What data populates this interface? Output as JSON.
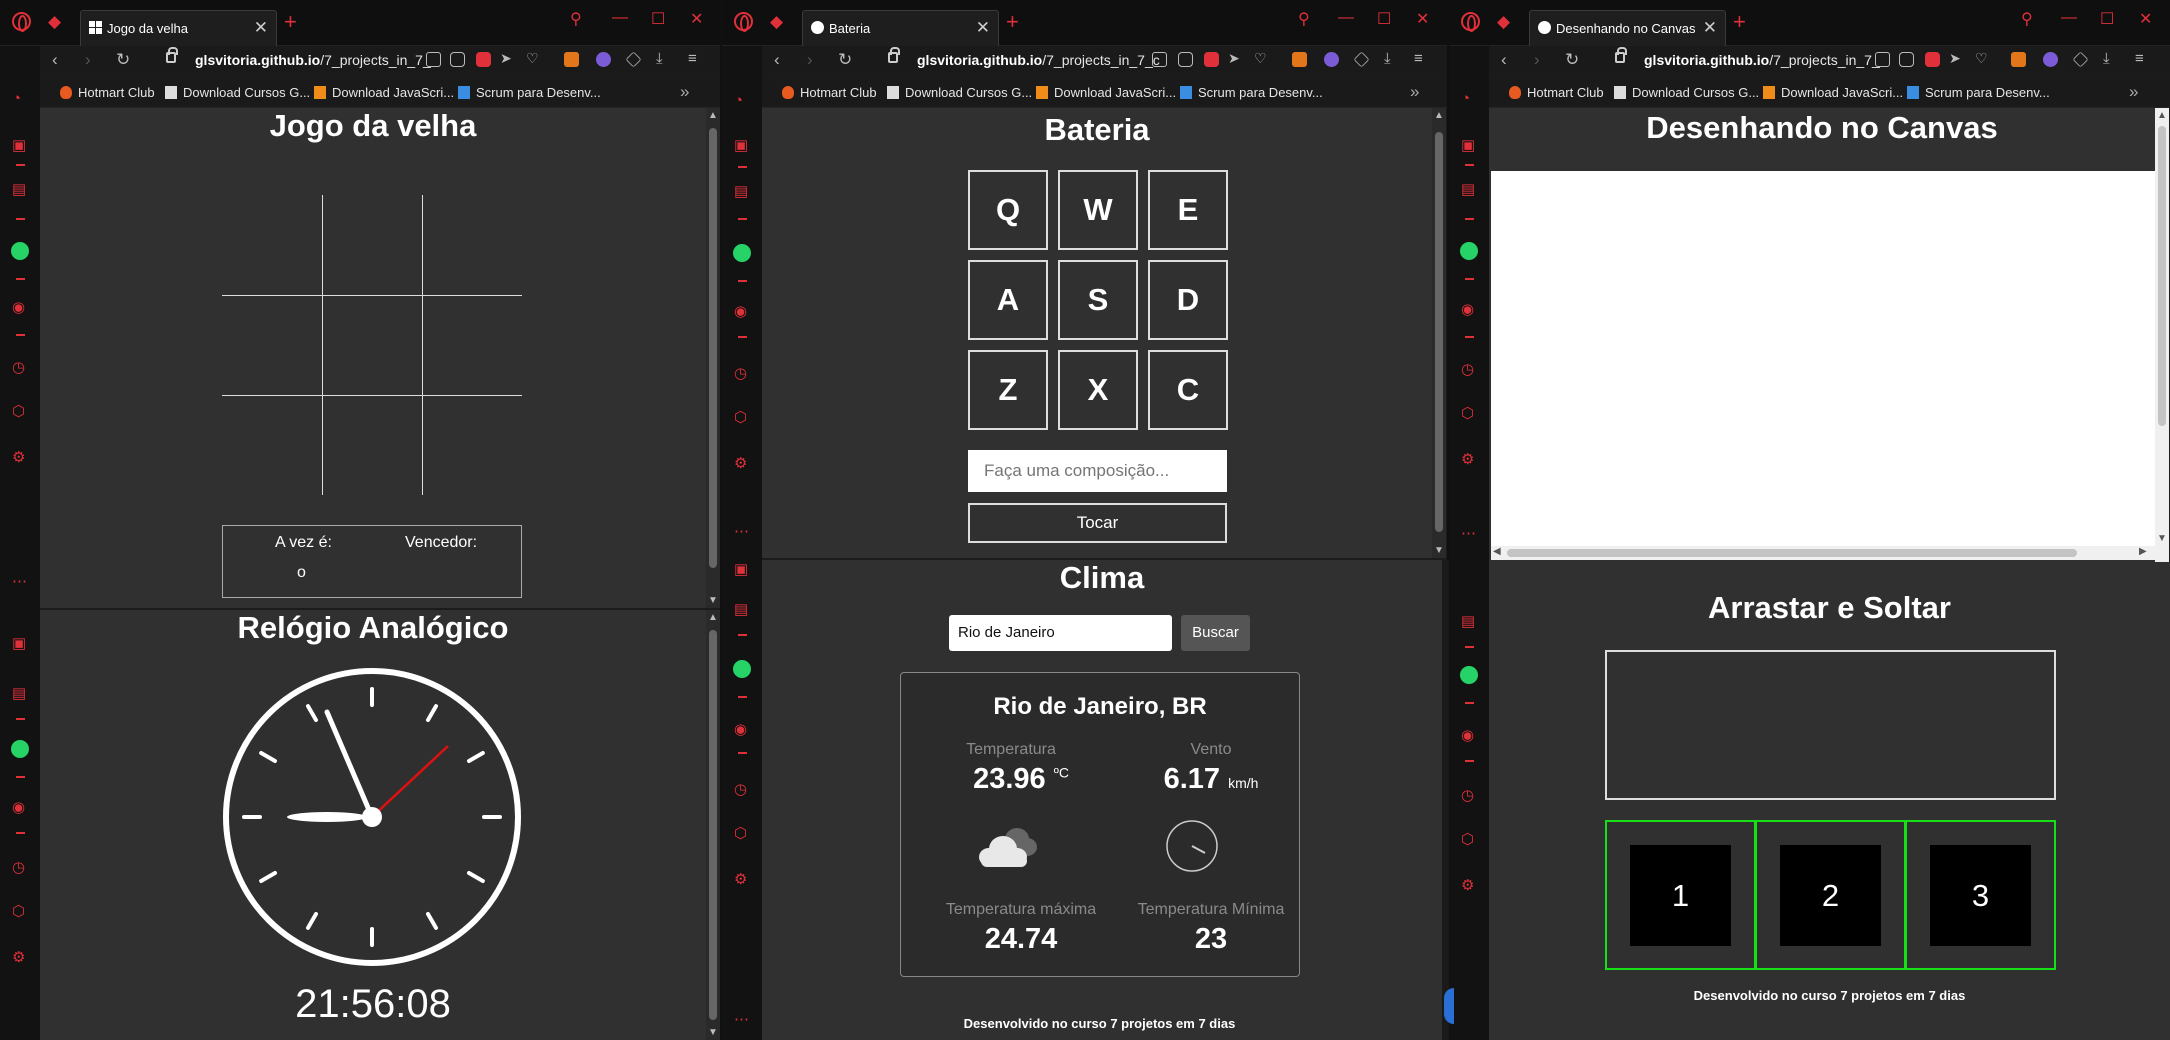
{
  "windows": [
    {
      "tab_title": "Jogo da velha",
      "url_host": "glsvitoria.github.io",
      "url_path": "/7_projects_in_7_"
    },
    {
      "tab_title": "Bateria",
      "url_host": "glsvitoria.github.io",
      "url_path": "/7_projects_in_7_c"
    },
    {
      "tab_title": "Desenhando no Canvas",
      "url_host": "glsvitoria.github.io",
      "url_path": "/7_projects_in_7_"
    }
  ],
  "bookmarks": [
    "Hotmart Club",
    "Download Cursos G...",
    "Download JavaScri...",
    "Scrum para Desenv..."
  ],
  "tictactoe": {
    "title": "Jogo da velha",
    "turn_label": "A vez é:",
    "turn_value": "o",
    "winner_label": "Vencedor:",
    "winner_value": ""
  },
  "clock": {
    "title": "Relógio Analógico",
    "time": "21:56:08"
  },
  "drums": {
    "title": "Bateria",
    "keys": [
      "Q",
      "W",
      "E",
      "A",
      "S",
      "D",
      "Z",
      "X",
      "C"
    ],
    "input_placeholder": "Faça uma composição...",
    "play_label": "Tocar"
  },
  "weather": {
    "title": "Clima",
    "city_input_value": "Rio de Janeiro",
    "search_label": "Buscar",
    "location": "Rio de Janeiro, BR",
    "temp_label": "Temperatura",
    "temp_value": "23.96",
    "temp_unit": "ºC",
    "wind_label": "Vento",
    "wind_value": "6.17",
    "wind_unit": "km/h",
    "max_label": "Temperatura máxima",
    "max_value": "24.74",
    "min_label": "Temperatura Mínima",
    "min_value": "23",
    "footer": "Desenvolvido no curso 7 projetos em 7 dias"
  },
  "canvas": {
    "title": "Desenhando no Canvas"
  },
  "dragdrop": {
    "title": "Arrastar e Soltar",
    "items": [
      "1",
      "2",
      "3"
    ],
    "footer": "Desenvolvido no curso 7 projetos em 7 dias"
  },
  "colors": {
    "accent": "#e0303a",
    "page_bg": "#303030",
    "slot_border": "#16e016"
  }
}
